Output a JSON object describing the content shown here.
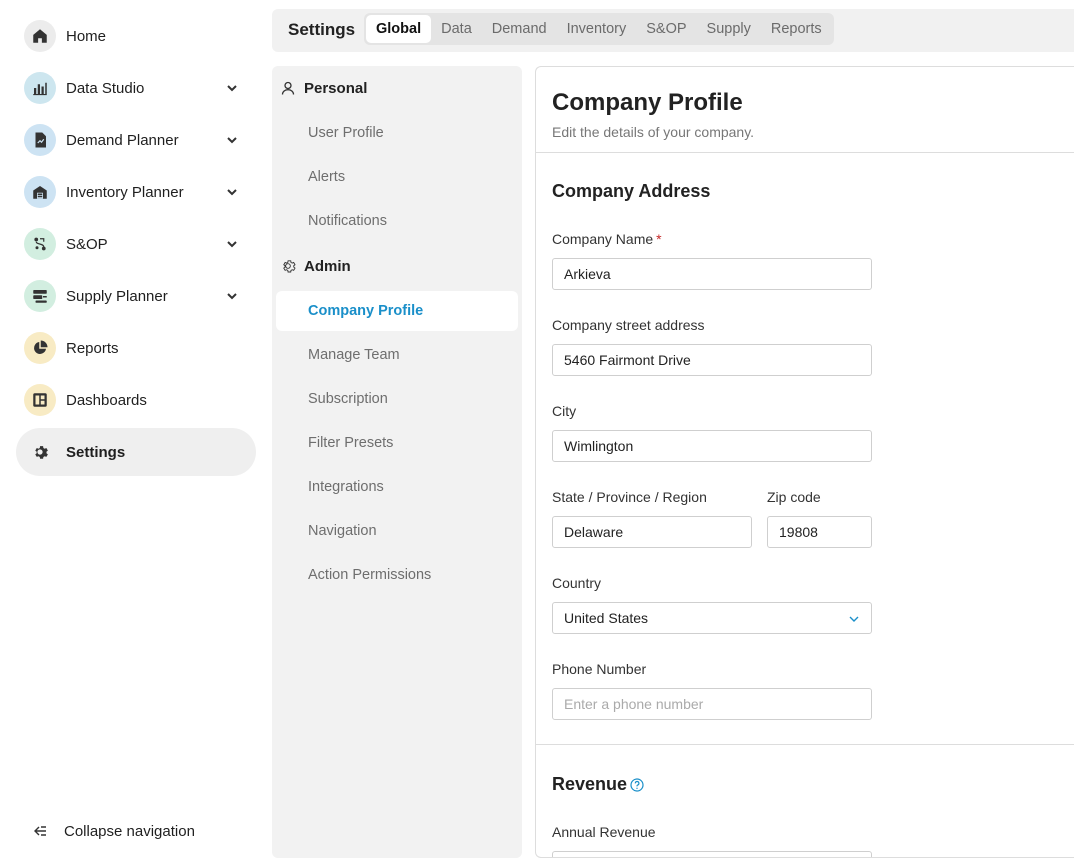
{
  "nav": {
    "items": [
      {
        "label": "Home",
        "icon": "home-icon",
        "expandable": false
      },
      {
        "label": "Data Studio",
        "icon": "data-studio-icon",
        "expandable": true
      },
      {
        "label": "Demand Planner",
        "icon": "demand-planner-icon",
        "expandable": true
      },
      {
        "label": "Inventory Planner",
        "icon": "inventory-planner-icon",
        "expandable": true
      },
      {
        "label": "S&OP",
        "icon": "sop-icon",
        "expandable": true
      },
      {
        "label": "Supply Planner",
        "icon": "supply-planner-icon",
        "expandable": true
      },
      {
        "label": "Reports",
        "icon": "reports-icon",
        "expandable": false
      },
      {
        "label": "Dashboards",
        "icon": "dashboards-icon",
        "expandable": false
      },
      {
        "label": "Settings",
        "icon": "gear-icon",
        "expandable": false,
        "active": true
      }
    ],
    "collapse_label": "Collapse navigation"
  },
  "tabbar": {
    "title": "Settings",
    "tabs": [
      "Global",
      "Data",
      "Demand",
      "Inventory",
      "S&OP",
      "Supply",
      "Reports"
    ],
    "active_tab": "Global"
  },
  "subnav": {
    "personal": {
      "label": "Personal",
      "items": [
        "User Profile",
        "Alerts",
        "Notifications"
      ]
    },
    "admin": {
      "label": "Admin",
      "items": [
        "Company Profile",
        "Manage Team",
        "Subscription",
        "Filter Presets",
        "Integrations",
        "Navigation",
        "Action Permissions"
      ]
    },
    "active_item": "Company Profile"
  },
  "main": {
    "title": "Company Profile",
    "subtitle": "Edit the details of your company.",
    "address": {
      "title": "Company Address",
      "company_name": {
        "label": "Company Name",
        "required": "*",
        "value": "Arkieva"
      },
      "street": {
        "label": "Company street address",
        "value": "5460 Fairmont Drive"
      },
      "city": {
        "label": "City",
        "value": "Wimlington"
      },
      "state": {
        "label": "State / Province / Region",
        "value": "Delaware"
      },
      "zip": {
        "label": "Zip code",
        "value": "19808"
      },
      "country": {
        "label": "Country",
        "value": "United States"
      },
      "phone": {
        "label": "Phone Number",
        "placeholder": "Enter a phone number",
        "value": ""
      }
    },
    "revenue": {
      "title": "Revenue",
      "annual_label": "Annual Revenue"
    }
  },
  "colors": {
    "accent": "#1a8fc9",
    "required": "#c62828",
    "nav_active_bg": "#efefef",
    "subnav_bg": "#f2f2f2"
  }
}
